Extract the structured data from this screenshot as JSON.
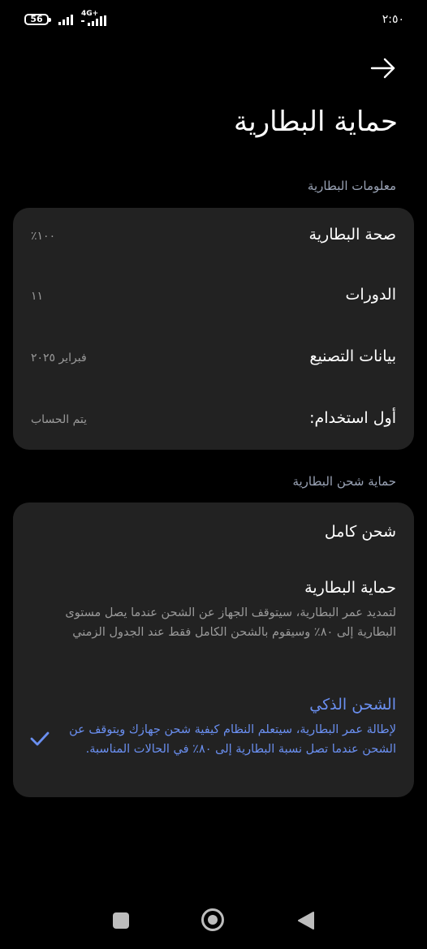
{
  "status_bar": {
    "battery": "56",
    "network": "4G+",
    "time": "٢:٥٠"
  },
  "header": {
    "back_icon": "arrow-right-icon",
    "title": "حماية البطارية"
  },
  "battery_info": {
    "section_title": "معلومات البطارية",
    "rows": [
      {
        "label": "صحة البطارية",
        "value": "١٠٠٪"
      },
      {
        "label": "الدورات",
        "value": "١١"
      },
      {
        "label": "بيانات التصنيع",
        "value": "فبراير ٢٠٢٥"
      },
      {
        "label": "أول استخدام:",
        "value": "يتم الحساب"
      }
    ]
  },
  "charging_protection": {
    "section_title": "حماية شحن البطارية",
    "options": [
      {
        "title": "شحن كامل",
        "description": "",
        "selected": false
      },
      {
        "title": "حماية البطارية",
        "description": "لتمديد عمر البطارية، سيتوقف الجهاز عن الشحن عندما يصل مستوى البطارية إلى ٨٠٪ وسيقوم بالشحن الكامل فقط عند الجدول الزمني",
        "selected": false
      },
      {
        "title": "الشحن الذكي",
        "description": "لإطالة عمر البطارية، سيتعلم النظام كيفية شحن جهازك ويتوقف عن الشحن عندما تصل نسبة البطارية إلى ٨٠٪ في الحالات المناسبة.",
        "selected": true
      }
    ],
    "check_icon": "checkmark-icon"
  },
  "colors": {
    "background": "#000000",
    "card": "#222222",
    "accent": "#6a8ff0",
    "secondary_text": "#9a9a9a",
    "section_text": "#9aa3b5"
  },
  "nav_bar": {
    "recents_icon": "square-icon",
    "home_icon": "circle-icon",
    "back_icon": "triangle-back-icon"
  }
}
